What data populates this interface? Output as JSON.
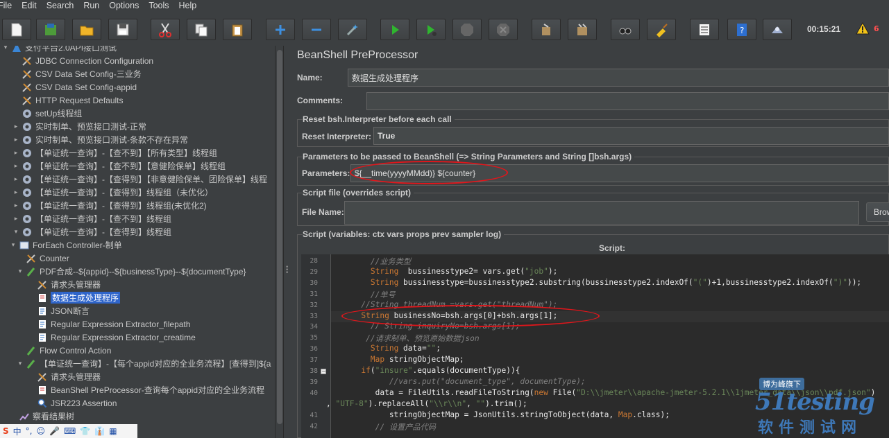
{
  "menu": [
    "File",
    "Edit",
    "Search",
    "Run",
    "Options",
    "Tools",
    "Help"
  ],
  "toolbar": {
    "clock": "00:15:21",
    "warning_count": "6"
  },
  "tree": {
    "items": [
      {
        "label": "支付平台2.0API接口测试",
        "indent": 0,
        "toggle": "▾",
        "icon": "test-plan-icon"
      },
      {
        "label": "JDBC Connection Configuration",
        "indent": 1,
        "toggle": "",
        "icon": "config-icon"
      },
      {
        "label": "CSV Data Set Config-三业务",
        "indent": 1,
        "toggle": "",
        "icon": "config-icon"
      },
      {
        "label": "CSV Data Set Config-appid",
        "indent": 1,
        "toggle": "",
        "icon": "config-icon"
      },
      {
        "label": "HTTP Request Defaults",
        "indent": 1,
        "toggle": "",
        "icon": "config-icon"
      },
      {
        "label": "setUp线程组",
        "indent": 1,
        "toggle": "",
        "icon": "gear-icon"
      },
      {
        "label": "实时制单、预览接口测试-正常",
        "indent": 1,
        "toggle": "▸",
        "icon": "gear-icon"
      },
      {
        "label": "实时制单、预览接口测试-条款不存在异常",
        "indent": 1,
        "toggle": "▸",
        "icon": "gear-icon"
      },
      {
        "label": "【单证统一查询】-【查不到】【所有类型】线程组",
        "indent": 1,
        "toggle": "▸",
        "icon": "gear-icon"
      },
      {
        "label": "【单证统一查询】-【查不到】【意健险保单】线程组",
        "indent": 1,
        "toggle": "▸",
        "icon": "gear-icon"
      },
      {
        "label": "【单证统一查询】-【查得到】【非意健险保单、团险保单】线程",
        "indent": 1,
        "toggle": "▸",
        "icon": "gear-icon"
      },
      {
        "label": "【单证统一查询】-【查得到】线程组（未优化）",
        "indent": 1,
        "toggle": "▸",
        "icon": "gear-icon"
      },
      {
        "label": "【单证统一查询】-【查得到】线程组(未优化2)",
        "indent": 1,
        "toggle": "▸",
        "icon": "gear-icon"
      },
      {
        "label": "【单证统一查询】-【查不到】线程组",
        "indent": 1,
        "toggle": "▸",
        "icon": "gear-icon"
      },
      {
        "label": "【单证统一查询】-【查得到】线程组",
        "indent": 1,
        "toggle": "▾",
        "icon": "gear-icon"
      },
      {
        "label": "ForEach Controller-制单",
        "indent": 2,
        "toggle": "▾",
        "icon": "controller-icon"
      },
      {
        "label": "Counter",
        "indent": 3,
        "toggle": "",
        "icon": "config-icon"
      },
      {
        "label": "PDF合成--${appid}--${businessType}--${documentType}",
        "indent": 3,
        "toggle": "▾",
        "icon": "sampler-icon"
      },
      {
        "label": "请求头管理器",
        "indent": 4,
        "toggle": "",
        "icon": "config-icon"
      },
      {
        "label": "数据生成处理程序",
        "indent": 4,
        "toggle": "",
        "icon": "script-icon",
        "selected": true
      },
      {
        "label": "JSON断言",
        "indent": 4,
        "toggle": "",
        "icon": "doc-icon"
      },
      {
        "label": "Regular Expression Extractor_filepath",
        "indent": 4,
        "toggle": "",
        "icon": "doc-icon"
      },
      {
        "label": "Regular Expression Extractor_creatime",
        "indent": 4,
        "toggle": "",
        "icon": "doc-icon"
      },
      {
        "label": "Flow Control Action",
        "indent": 3,
        "toggle": "",
        "icon": "sampler-icon"
      },
      {
        "label": "【单证统一查询】-【每个appid对应的全业务流程】[查得到]${a",
        "indent": 3,
        "toggle": "▾",
        "icon": "sampler-icon"
      },
      {
        "label": "请求头管理器",
        "indent": 4,
        "toggle": "",
        "icon": "config-icon"
      },
      {
        "label": "BeanShell PreProcessor-查询每个appid对应的全业务流程",
        "indent": 4,
        "toggle": "",
        "icon": "script-icon"
      },
      {
        "label": "JSR223 Assertion",
        "indent": 4,
        "toggle": "",
        "icon": "search-icon"
      },
      {
        "label": "察看结果树",
        "indent": 2,
        "toggle": "",
        "icon": "chart-icon"
      }
    ]
  },
  "panel": {
    "title": "BeanShell PreProcessor",
    "name_label": "Name:",
    "name_value": "数据生成处理程序",
    "comments_label": "Comments:",
    "comments_value": "",
    "reset_group": "Reset bsh.Interpreter before each call",
    "reset_label": "Reset Interpreter:",
    "reset_value": "True",
    "params_group": "Parameters to be passed to BeanShell (=> String Parameters and String []bsh.args)",
    "params_label": "Parameters:",
    "params_value": "${__time(yyyyMMdd)} ${counter}",
    "file_group": "Script file (overrides script)",
    "file_label": "File Name:",
    "file_value": "",
    "browse_label": "Browse...",
    "script_group": "Script (variables: ctx vars props prev sampler log)",
    "script_header": "Script:"
  },
  "code": {
    "lines": [
      {
        "n": "28",
        "text": "        //业务类型"
      },
      {
        "n": "29",
        "text": "        String  bussinesstype2= vars.get(\"job\");"
      },
      {
        "n": "30",
        "text": "        String bussinesstype=bussinesstype2.substring(bussinesstype2.indexOf(\"(\")+1,bussinesstype2.indexOf(\")\"));"
      },
      {
        "n": "31",
        "text": "        //单号"
      },
      {
        "n": "32",
        "text": "      //String threadNum =vars.get(\"threadNum\");"
      },
      {
        "n": "33",
        "text": "      String businessNo=bsh.args[0]+bsh.args[1];"
      },
      {
        "n": "34",
        "text": "        // String inquiryNo=bsh.args[1];"
      },
      {
        "n": "35",
        "text": "       //请求制单、预览原始数据json"
      },
      {
        "n": "36",
        "text": "        String data=\"\";"
      },
      {
        "n": "37",
        "text": "        Map stringObjectMap;"
      },
      {
        "n": "38",
        "text": "      if(\"insure\".equals(documentType)){"
      },
      {
        "n": "39",
        "text": "            //vars.put(\"document_type\", documentType);"
      },
      {
        "n": "40",
        "text": "         data = FileUtils.readFileToString(new File(\"D:\\\\jmeter\\\\apache-jmeter-5.2.1\\\\1jmeter_data\\\\json\\\\pdf.json\")"
      },
      {
        "n": "",
        "text": ", \"UTF-8\").replaceAll(\"\\\\r\\\\n\", \"\").trim();"
      },
      {
        "n": "41",
        "text": "            stringObjectMap = JsonUtils.stringToObject(data, Map.class);"
      },
      {
        "n": "42",
        "text": "         // 设置产品代码"
      }
    ]
  },
  "watermark": {
    "line1": "博为峰旗下",
    "line2": "51testing",
    "line3": "软件测试网"
  },
  "ime": [
    "S",
    "中",
    "°,",
    "☺",
    "🎤",
    "⌨",
    "👕",
    "👔",
    "▦"
  ]
}
